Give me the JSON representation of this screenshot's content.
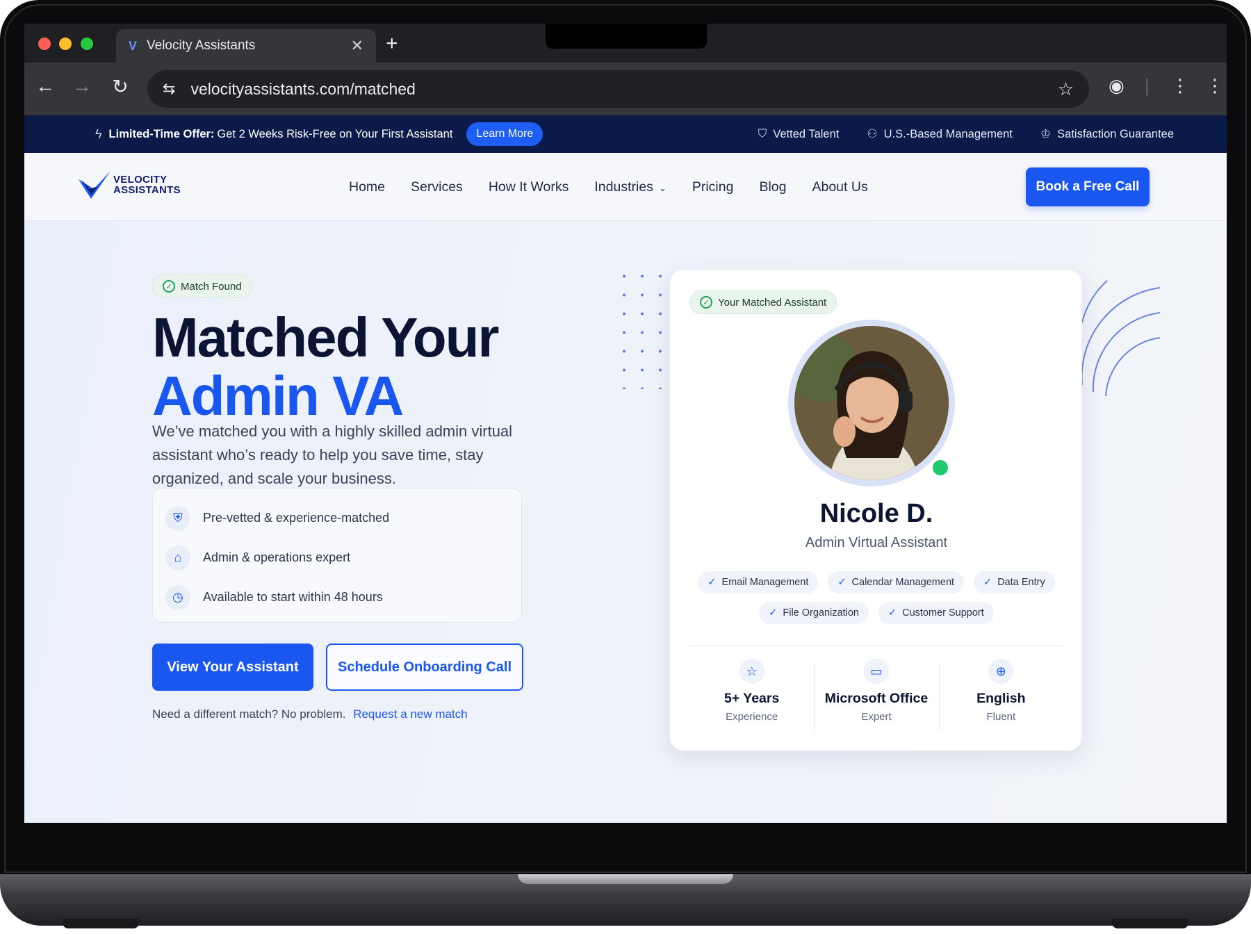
{
  "browser": {
    "tab_title": "Velocity Assistants",
    "tab_close": "✕",
    "new_tab": "+",
    "url": "velocityassistants.com/matched"
  },
  "promo": {
    "lead": "Limited-Time Offer:",
    "text": "Get 2 Weeks Risk-Free on Your First Assistant",
    "button": "Learn More",
    "badges": [
      "Vetted Talent",
      "U.S.-Based Management",
      "Satisfaction Guarantee"
    ]
  },
  "nav": {
    "logo_line1": "VELOCITY",
    "logo_line2": "ASSISTANTS",
    "links": [
      "Home",
      "Services",
      "How It Works",
      "Industries",
      "Pricing",
      "Blog",
      "About Us"
    ],
    "cta": "Book a Free Call"
  },
  "hero": {
    "badge": "Match Found",
    "title_line1": "Matched Your",
    "title_line2": "Admin VA",
    "description": "We’ve matched you with a highly skilled admin virtual assistant who’s ready to help you save time, stay organized, and scale your business.",
    "features": [
      "Pre-vetted & experience-matched",
      "Admin & operations expert",
      "Available to start within 48 hours"
    ],
    "primary_button": "View Your Assistant",
    "secondary_button": "Schedule Onboarding Call",
    "rematch_text": "Need a different match? No problem.",
    "rematch_link": "Request a new match"
  },
  "card": {
    "badge": "Your Matched Assistant",
    "name": "Nicole D.",
    "role": "Admin Virtual Assistant",
    "skills": [
      "Email Management",
      "Calendar Management",
      "Data Entry",
      "File Organization",
      "Customer Support"
    ],
    "stats": [
      {
        "value": "5+ Years",
        "label": "Experience",
        "icon": "star-icon"
      },
      {
        "value": "Microsoft Office",
        "label": "Expert",
        "icon": "monitor-icon"
      },
      {
        "value": "English",
        "label": "Fluent",
        "icon": "globe-icon"
      }
    ]
  },
  "colors": {
    "brand_blue": "#1a56f0",
    "promo_bg": "#0c1a4a",
    "online_green": "#1ec86a"
  }
}
